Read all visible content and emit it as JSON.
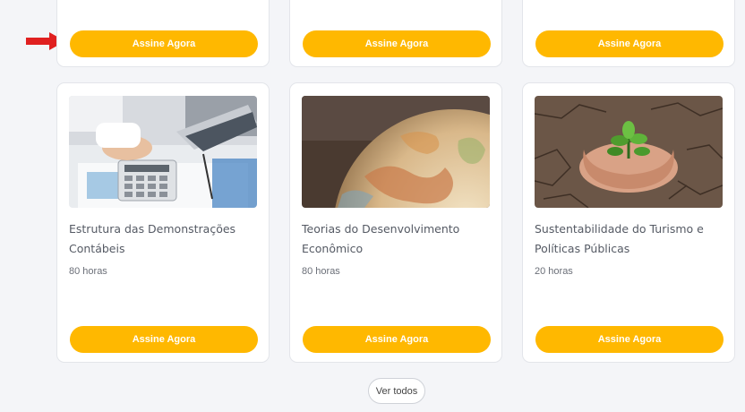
{
  "top_row": [
    {
      "button_label": "Assine Agora"
    },
    {
      "button_label": "Assine Agora"
    },
    {
      "button_label": "Assine Agora"
    }
  ],
  "courses": [
    {
      "title": "Estrutura das Demonstrações Contábeis",
      "hours": "80 horas",
      "button_label": "Assine Agora",
      "image": "accounting-calculator-photo"
    },
    {
      "title": "Teorias do Desenvolvimento Econômico",
      "hours": "80 horas",
      "button_label": "Assine Agora",
      "image": "globe-photo"
    },
    {
      "title": "Sustentabilidade do Turismo e Políticas Públicas",
      "hours": "20 horas",
      "button_label": "Assine Agora",
      "image": "hands-plant-photo"
    }
  ],
  "see_all_label": "Ver todos",
  "colors": {
    "accent": "#ffb800",
    "arrow": "#e02020",
    "background": "#f4f5f8"
  },
  "indicator": "red-arrow-icon"
}
